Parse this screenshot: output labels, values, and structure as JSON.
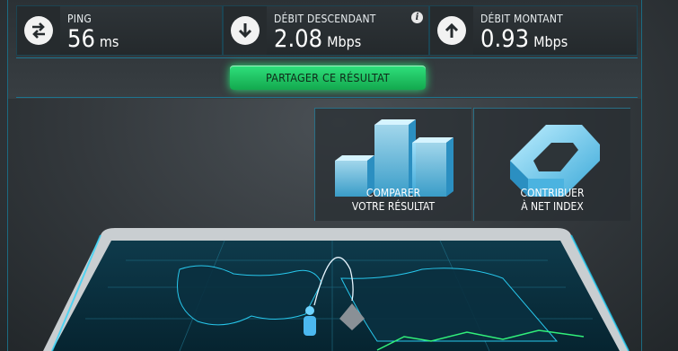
{
  "stats": {
    "ping": {
      "label": "PING",
      "value": "56",
      "unit": "ms",
      "icon": "ping-arrows-icon"
    },
    "download": {
      "label": "DÉBIT DESCENDANT",
      "value": "2.08",
      "unit": "Mbps",
      "icon": "download-arrow-icon",
      "info": "i"
    },
    "upload": {
      "label": "DÉBIT MONTANT",
      "value": "0.93",
      "unit": "Mbps",
      "icon": "upload-arrow-icon"
    }
  },
  "share_button": {
    "label": "PARTAGER CE RÉSULTAT"
  },
  "tiles": {
    "compare": {
      "line1": "COMPARER",
      "line2": "VOTRE RÉSULTAT",
      "icon": "bar-chart-icon"
    },
    "contribute": {
      "line1": "CONTRIBUER",
      "line2": "À NET INDEX",
      "icon": "net-index-logo-icon"
    }
  },
  "colors": {
    "accent": "#1e7590",
    "share": "#1fc862",
    "map_line": "#2bd8ff"
  }
}
